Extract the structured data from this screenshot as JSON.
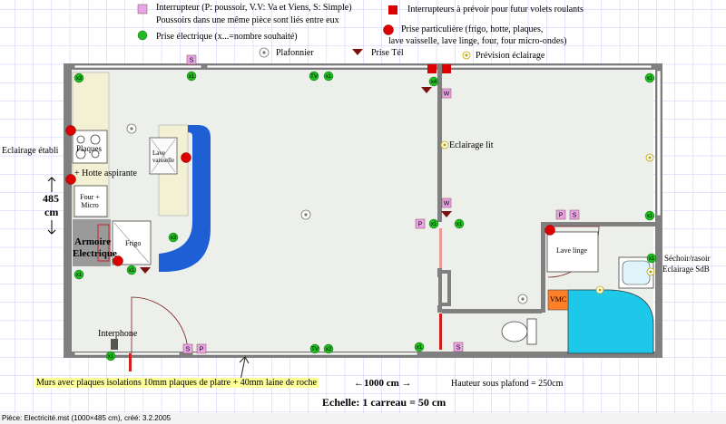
{
  "legend": {
    "interrupteur": "Interrupteur (P: poussoir, V.V: Va et Viens, S: Simple)",
    "poussoirs": "Poussoirs dans une même pièce sont liés entre eux",
    "prise_electrique": "Prise électrique (x...=nombre souhaité)",
    "plafonnier": "Plafonnier",
    "prise_tel": "Prise Tél",
    "prevision_eclairage": "Prévision éclairage",
    "interrupteurs_volets": "Interrupteurs à prévoir pour futur volets roulants",
    "prise_particuliere_1": "Prise particulière (frigo, hotte, plaques,",
    "prise_particuliere_2": "lave vaisselle, lave linge, four, four micro-ondes)"
  },
  "labels": {
    "eclairage_etabli": "Eclairage établi",
    "plaques": "Plaques",
    "hotte": "+ Hotte aspirante",
    "four_micro": "Four + Micro",
    "lave_vaisselle": "Lave vaisselle",
    "frigo": "Frigo",
    "armoire_1": "Armoire",
    "armoire_2": "Electrique",
    "interphone": "Interphone",
    "eclairage_lit": "Eclairage lit",
    "lave_linge": "Lave linge",
    "vmc": "VMC",
    "sechoir": "Séchoir/rasoir",
    "eclairage_sdb": "Eclairage SdB",
    "dim_height_value": "485",
    "dim_height_unit": "cm",
    "dim_width": "←1000 cm →",
    "hauteur": "Hauteur sous plafond = 250cm",
    "murs": "Murs avec plaques isolations 10mm plaques de platre + 40mm laine de roche",
    "echelle": "Echelle: 1 carreau = 50 cm",
    "status": "Pièce: Electricité.mst (1000×485 cm), créé: 3.2.2005"
  },
  "symbols": {
    "x1": "x1",
    "x2": "x2",
    "x3": "x3",
    "x4": "x4",
    "s": "S",
    "p": "P",
    "w": "W",
    "tv": "TV"
  },
  "colors": {
    "grid": "#c8c8ff",
    "wall": "#808080",
    "floor": "#ecefea",
    "counter": "#f3f1d4",
    "switch": "#e7a4e7",
    "outlet": "#22bb22",
    "special": "#dd0000",
    "blue_counter": "#1e5fd6",
    "vmc": "#ff7f27",
    "shower": "#1ec8e8"
  }
}
